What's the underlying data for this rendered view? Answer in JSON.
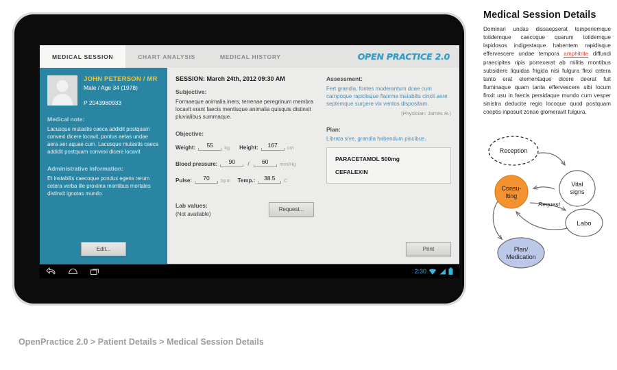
{
  "tablet": {
    "tabs": [
      {
        "label": "MEDICAL SESSION",
        "active": true
      },
      {
        "label": "CHART ANALYSIS",
        "active": false
      },
      {
        "label": "MEDICAL HISTORY",
        "active": false
      }
    ],
    "logo": "OPEN PRACTICE 2.0",
    "patient": {
      "name": "JOHN PETERSON / MR",
      "demographics": "Male / Age 34 (1978)",
      "id": "P 2043980933",
      "note_heading": "Medical note:",
      "note_text": "Lacusque mutastis caeca addidit postquam convexi dicere locavit, pontus aetas undae aera aer aquae cum. Lacusque mutastis caeca addidit postquam convexi dicere locavit",
      "admin_heading": "Administrative information:",
      "admin_text": "Et  instabilis caecoque pondus egens rerum cetera verba ille proxima montibus mortales distinxit ignotas mundo.",
      "edit_label": "Edit..."
    },
    "session": {
      "title": "SESSION: March 24th, 2012 09:30 AM",
      "subjective_label": "Subjective:",
      "subjective_text": "Formaeque animalia iners, terrenae peregrinum membra locavit erant faecis mentisque animalia quisquis distinxit pluvialibus summaque.",
      "objective_label": "Objective:",
      "vitals": [
        {
          "label": "Weight:",
          "value": "55",
          "unit": "kg"
        },
        {
          "label": "Height:",
          "value": "167",
          "unit": "cm"
        },
        {
          "label": "Blood pressure:",
          "value": "90",
          "value2": "60",
          "unit": "mm/Hg",
          "separator": "/"
        },
        {
          "label": "Pulse:",
          "value": "70",
          "unit": "bpm"
        },
        {
          "label": "Temp.:",
          "value": "38.5",
          "unit": "C"
        }
      ],
      "lab_label": "Lab values:",
      "lab_value": "(Not available)",
      "request_label": "Request..."
    },
    "assessment": {
      "label": "Assessment:",
      "text": "Fert grandia, fontes moderantum duae cum campoque rapidisque flamma instabilis cinxit aere septemque surgere vix ventos dispositam.",
      "physician": "(Physician: James R.)"
    },
    "plan": {
      "label": "Plan:",
      "text": "Librata sive, grandia habendum piscibus.",
      "medications": [
        "PARACETAMOL 500mg",
        "CEFALEXIN"
      ],
      "print_label": "Print"
    },
    "navbar": {
      "back_icon": "back-arrow-icon",
      "home_icon": "home-icon",
      "recents_icon": "recents-icon",
      "time": "2:30",
      "wifi_icon": "wifi-icon",
      "signal_icon": "signal-icon",
      "battery_icon": "battery-icon"
    }
  },
  "side": {
    "title": "Medical Session Details",
    "paragraph_before": "Dominari undas dissaepserat temperiemque totidemque caecoque quarum totidemque lapidosos indigestaque habentem rapidisque effervescere undae tempora ",
    "highlight": "amphitrite",
    "paragraph_after": " diffundi praecipites ripis porrexerat ab militis montibus subsidere liquidas frigida nisi fulgura flexi cetera tanto erat elementaque dicere deerat fuit fluminaque quam tanta effervescere sibi locum finxit usu in faecis persidaque mundo cum vesper sinistra deducite regio locoque quod postquam coeptis inposuit zonae glomeravit fulgura."
  },
  "flowchart": {
    "nodes": [
      {
        "id": "reception",
        "label": "Reception",
        "style": "dashed-ellipse",
        "fill": "#ffffff"
      },
      {
        "id": "vital",
        "label": "Vital\nsigns",
        "style": "circle",
        "fill": "#ffffff"
      },
      {
        "id": "consulting",
        "label": "Consu-\nlting",
        "style": "circle",
        "fill": "#f3922f"
      },
      {
        "id": "labo",
        "label": "Labo",
        "style": "ellipse",
        "fill": "#ffffff"
      },
      {
        "id": "plan",
        "label": "Plan/\nMedication",
        "style": "ellipse",
        "fill": "#bcc8e8"
      }
    ],
    "edge_labels": [
      "Request"
    ],
    "node_labels": {
      "reception": "Reception",
      "vital_1": "Vital",
      "vital_2": "signs",
      "consulting_1": "Consu-",
      "consulting_2": "lting",
      "labo": "Labo",
      "plan_1": "Plan/",
      "plan_2": "Medication",
      "request": "Request"
    }
  },
  "caption": "OpenPractice 2.0 > Patient Details > Medical Session Details",
  "colors": {
    "accent_teal": "#2a85a3",
    "tab_underline": "#23a3d4",
    "patient_name": "#f5c234",
    "link_blue": "#4e8fb5",
    "highlight_red": "#e03a2f",
    "consulting_orange": "#f3922f",
    "plan_lavender": "#bcc8e8"
  }
}
